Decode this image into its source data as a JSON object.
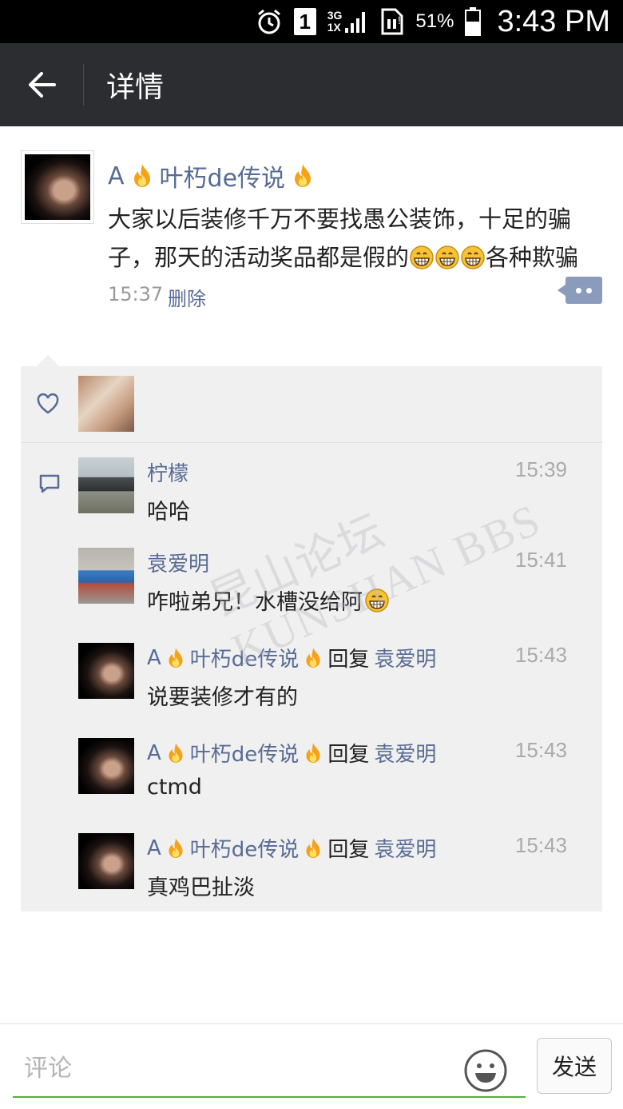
{
  "status_bar": {
    "network_top": "3G",
    "network_bottom": "1X",
    "sim_slot": "1",
    "battery": "51%",
    "time": "3:43 PM"
  },
  "app_bar": {
    "title": "详情"
  },
  "post": {
    "author_prefix": "A",
    "author_name": "叶朽de传说",
    "text_before_emoji": "大家以后装修千万不要找愚公装饰，十足的骗子，那天的活动奖品都是假的",
    "text_after_emoji": "各种欺骗",
    "time": "15:37",
    "delete_label": "删除"
  },
  "comments": [
    {
      "name": "柠檬",
      "time": "15:39",
      "text": "哈哈"
    },
    {
      "name": "袁爱明",
      "time": "15:41",
      "text": "咋啦弟兄！水槽没给阿"
    },
    {
      "name_prefix": "A",
      "name": "叶朽de传说",
      "reply_label": "回复",
      "reply_to": "袁爱明",
      "time": "15:43",
      "text": "说要装修才有的"
    },
    {
      "name_prefix": "A",
      "name": "叶朽de传说",
      "reply_label": "回复",
      "reply_to": "袁爱明",
      "time": "15:43",
      "text": "ctmd"
    },
    {
      "name_prefix": "A",
      "name": "叶朽de传说",
      "reply_label": "回复",
      "reply_to": "袁爱明",
      "time": "15:43",
      "text": "真鸡巴扯淡"
    }
  ],
  "watermark": "昆山论坛 KUNSHAN BBS",
  "bottom_bar": {
    "placeholder": "评论",
    "send_label": "发送"
  }
}
